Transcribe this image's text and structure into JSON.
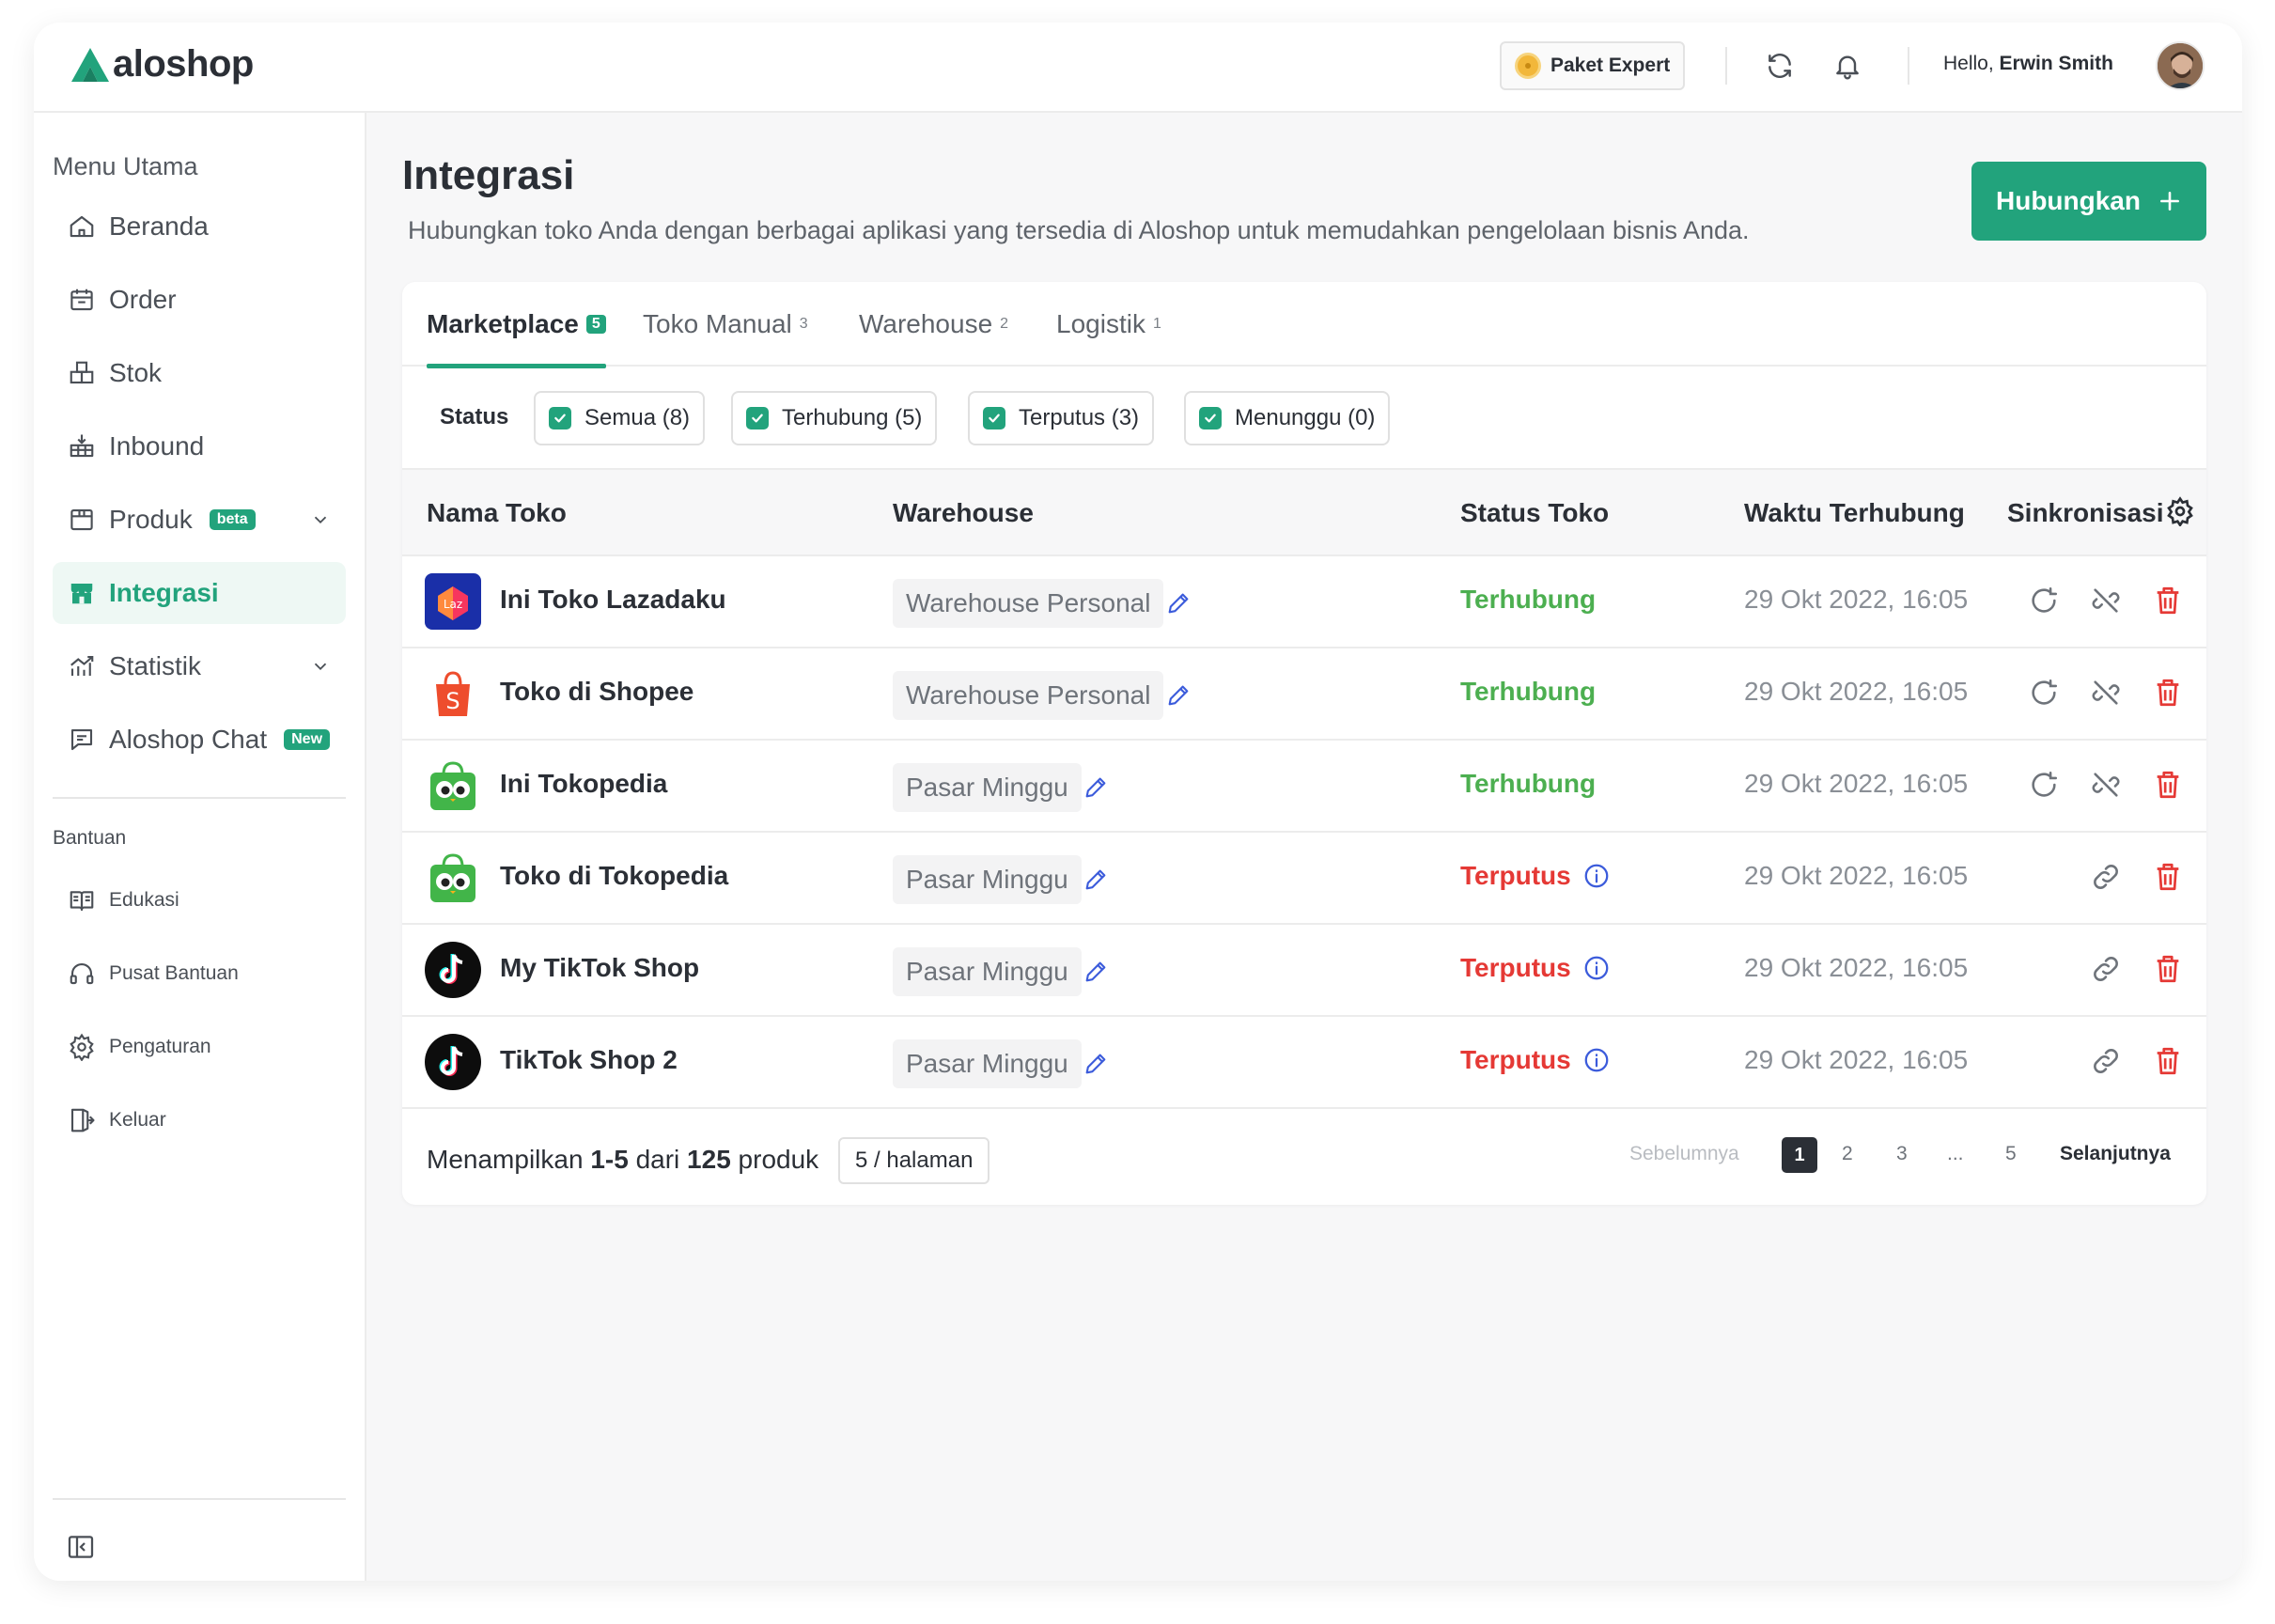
{
  "app": {
    "brand": "aloshop"
  },
  "topbar": {
    "plan_label": "Paket Expert",
    "greeting": "Hello,",
    "user_name": "Erwin Smith"
  },
  "sidebar": {
    "main_heading": "Menu Utama",
    "items": [
      {
        "label": "Beranda",
        "icon": "home-icon"
      },
      {
        "label": "Order",
        "icon": "calendar-icon"
      },
      {
        "label": "Stok",
        "icon": "boxes-icon"
      },
      {
        "label": "Inbound",
        "icon": "inbound-icon"
      },
      {
        "label": "Produk",
        "icon": "package-icon",
        "badge": "beta"
      },
      {
        "label": "Integrasi",
        "icon": "store-icon",
        "active": true
      },
      {
        "label": "Statistik",
        "icon": "chart-icon"
      },
      {
        "label": "Aloshop Chat",
        "icon": "chat-icon",
        "badge": "New"
      }
    ],
    "help_heading": "Bantuan",
    "help_items": [
      {
        "label": "Edukasi",
        "icon": "book-icon"
      },
      {
        "label": "Pusat Bantuan",
        "icon": "headset-icon"
      },
      {
        "label": "Pengaturan",
        "icon": "gear-icon"
      },
      {
        "label": "Keluar",
        "icon": "logout-icon"
      }
    ]
  },
  "page": {
    "title": "Integrasi",
    "subtitle": "Hubungkan toko Anda dengan berbagai aplikasi yang tersedia di Aloshop untuk memudahkan pengelolaan bisnis Anda.",
    "primary_button": "Hubungkan"
  },
  "tabs": [
    {
      "label": "Marketplace",
      "count": "5",
      "active": true
    },
    {
      "label": "Toko Manual",
      "count": "3"
    },
    {
      "label": "Warehouse",
      "count": "2"
    },
    {
      "label": "Logistik",
      "count": "1"
    }
  ],
  "filters": {
    "label": "Status",
    "chips": [
      "Semua (8)",
      "Terhubung (5)",
      "Terputus (3)",
      "Menunggu (0)"
    ]
  },
  "table": {
    "columns": [
      "Nama Toko",
      "Warehouse",
      "Status Toko",
      "Waktu Terhubung",
      "Sinkronisasi"
    ],
    "rows": [
      {
        "name": "Ini Toko Lazadaku",
        "platform": "lazada",
        "warehouse": "Warehouse Personal",
        "status": "Terhubung",
        "time": "29 Okt 2022, 16:05"
      },
      {
        "name": "Toko di Shopee",
        "platform": "shopee",
        "warehouse": "Warehouse Personal",
        "status": "Terhubung",
        "time": "29 Okt 2022, 16:05"
      },
      {
        "name": "Ini Tokopedia",
        "platform": "tokopedia",
        "warehouse": "Pasar Minggu",
        "status": "Terhubung",
        "time": "29 Okt 2022, 16:05"
      },
      {
        "name": "Toko di Tokopedia",
        "platform": "tokopedia",
        "warehouse": "Pasar Minggu",
        "status": "Terputus",
        "time": "29 Okt 2022, 16:05"
      },
      {
        "name": "My TikTok Shop",
        "platform": "tiktok",
        "warehouse": "Pasar Minggu",
        "status": "Terputus",
        "time": "29 Okt 2022, 16:05"
      },
      {
        "name": "TikTok Shop 2",
        "platform": "tiktok",
        "warehouse": "Pasar Minggu",
        "status": "Terputus",
        "time": "29 Okt 2022, 16:05"
      }
    ]
  },
  "pagination": {
    "showing_prefix": "Menampilkan",
    "range": "1-5",
    "of": "dari",
    "total": "125",
    "unit": "produk",
    "per_page": "5 / halaman",
    "prev": "Sebelumnya",
    "pages": [
      "1",
      "2",
      "3",
      "...",
      "5"
    ],
    "current": "1",
    "next": "Selanjutnya"
  },
  "colors": {
    "accent": "#22a37c",
    "connected": "#4caf50",
    "disconnected": "#e53935",
    "info": "#3b5bdb"
  }
}
